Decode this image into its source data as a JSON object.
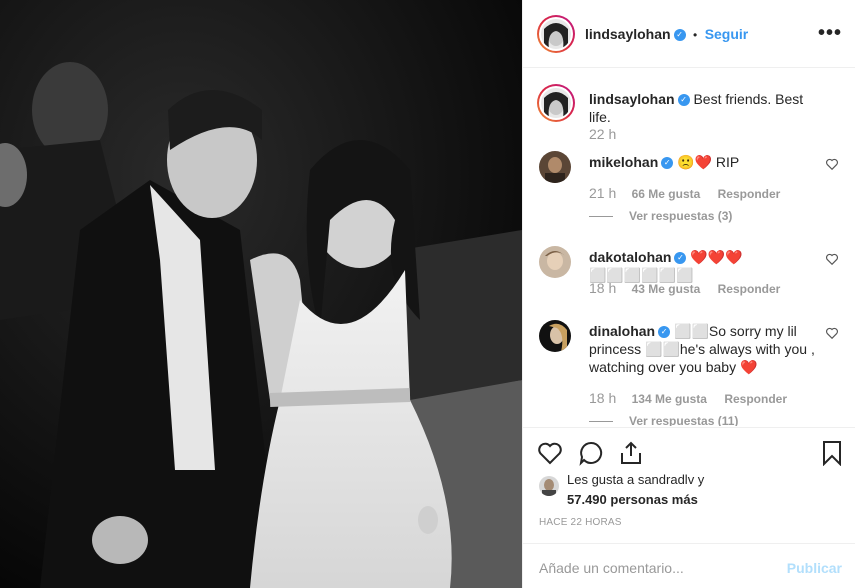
{
  "post": {
    "author": "lindsaylohan",
    "follow_label": "Seguir",
    "more_label": "•••",
    "dot_separator": "•",
    "caption": "Best friends. Best life.",
    "caption_time": "22 h"
  },
  "comments": [
    {
      "user": "mikelohan",
      "text_prefix": "",
      "text": "RIP",
      "emoji": "🙁❤️",
      "time": "21 h",
      "likes": "66 Me gusta",
      "reply": "Responder",
      "view_replies": "Ver respuestas (3)"
    },
    {
      "user": "dakotalohan",
      "text_prefix": "",
      "text": "❤️❤️❤️⬜⬜⬜⬜⬜⬜",
      "emoji": "",
      "time": "18 h",
      "likes": "43 Me gusta",
      "reply": "Responder",
      "view_replies": ""
    },
    {
      "user": "dinalohan",
      "text_prefix": "⬜⬜",
      "text": "So sorry my lil princess ⬜⬜he's always with you , watching over you baby ❤️",
      "emoji": "",
      "time": "18 h",
      "likes": "134 Me gusta",
      "reply": "Responder",
      "view_replies": "Ver respuestas (11)"
    }
  ],
  "likes": {
    "line1": "Les gusta a sandradlv y",
    "line2": "57.490 personas más"
  },
  "time_ago": "HACE 22 HORAS",
  "add_comment": {
    "placeholder": "Añade un comentario...",
    "publish_label": "Publicar"
  }
}
